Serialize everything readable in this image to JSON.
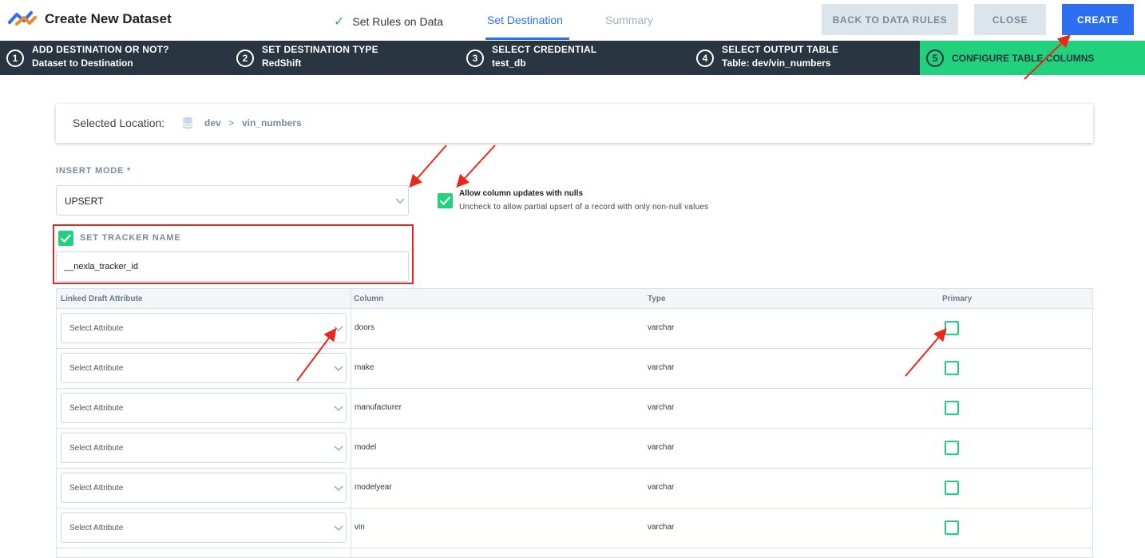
{
  "header": {
    "title": "Create New Dataset",
    "tabs": [
      {
        "label": "Set Rules on Data",
        "state": "done"
      },
      {
        "label": "Set Destination",
        "state": "active"
      },
      {
        "label": "Summary",
        "state": "upcoming"
      }
    ],
    "buttons": {
      "back": "BACK TO DATA RULES",
      "close": "CLOSE",
      "create": "CREATE"
    }
  },
  "stepper": [
    {
      "num": "1",
      "title": "ADD DESTINATION OR NOT?",
      "subtitle": "Dataset to Destination"
    },
    {
      "num": "2",
      "title": "SET DESTINATION TYPE",
      "subtitle": "RedShift"
    },
    {
      "num": "3",
      "title": "SELECT CREDENTIAL",
      "subtitle": "test_db"
    },
    {
      "num": "4",
      "title": "SELECT OUTPUT TABLE",
      "subtitle": "Table: dev/vin_numbers"
    },
    {
      "num": "5",
      "title": "CONFIGURE TABLE COLUMNS",
      "subtitle": ""
    }
  ],
  "location": {
    "label": "Selected Location:",
    "database": "dev",
    "separator": ">",
    "table": "vin_numbers"
  },
  "insert_mode": {
    "label": "INSERT MODE *",
    "value": "UPSERT"
  },
  "nulls_option": {
    "checked": true,
    "title": "Allow column updates with nulls",
    "subtitle": "Uncheck to allow partial upsert of a record with only non-null values"
  },
  "tracker": {
    "checked": true,
    "label": "SET TRACKER NAME",
    "value": "__nexla_tracker_id"
  },
  "table": {
    "headers": {
      "linked": "Linked Draft Attribute",
      "column": "Column",
      "type": "Type",
      "primary": "Primary"
    },
    "rows": [
      {
        "attribute": "Select Attribute",
        "column": "doors",
        "type": "varchar",
        "primary": false
      },
      {
        "attribute": "Select Attribute",
        "column": "make",
        "type": "varchar",
        "primary": false
      },
      {
        "attribute": "Select Attribute",
        "column": "manufacturer",
        "type": "varchar",
        "primary": false
      },
      {
        "attribute": "Select Attribute",
        "column": "model",
        "type": "varchar",
        "primary": false
      },
      {
        "attribute": "Select Attribute",
        "column": "modelyear",
        "type": "varchar",
        "primary": false
      },
      {
        "attribute": "Select Attribute",
        "column": "vin",
        "type": "varchar",
        "primary": false
      }
    ]
  },
  "colors": {
    "accent": "#2c6ff0",
    "success": "#22d17c",
    "stepper_bg": "#2a3542",
    "annotation": "#e8281b"
  },
  "icons": [
    "logo-icon",
    "checkmark-icon",
    "database-icon",
    "chevron-down-icon",
    "checkbox-icon"
  ]
}
